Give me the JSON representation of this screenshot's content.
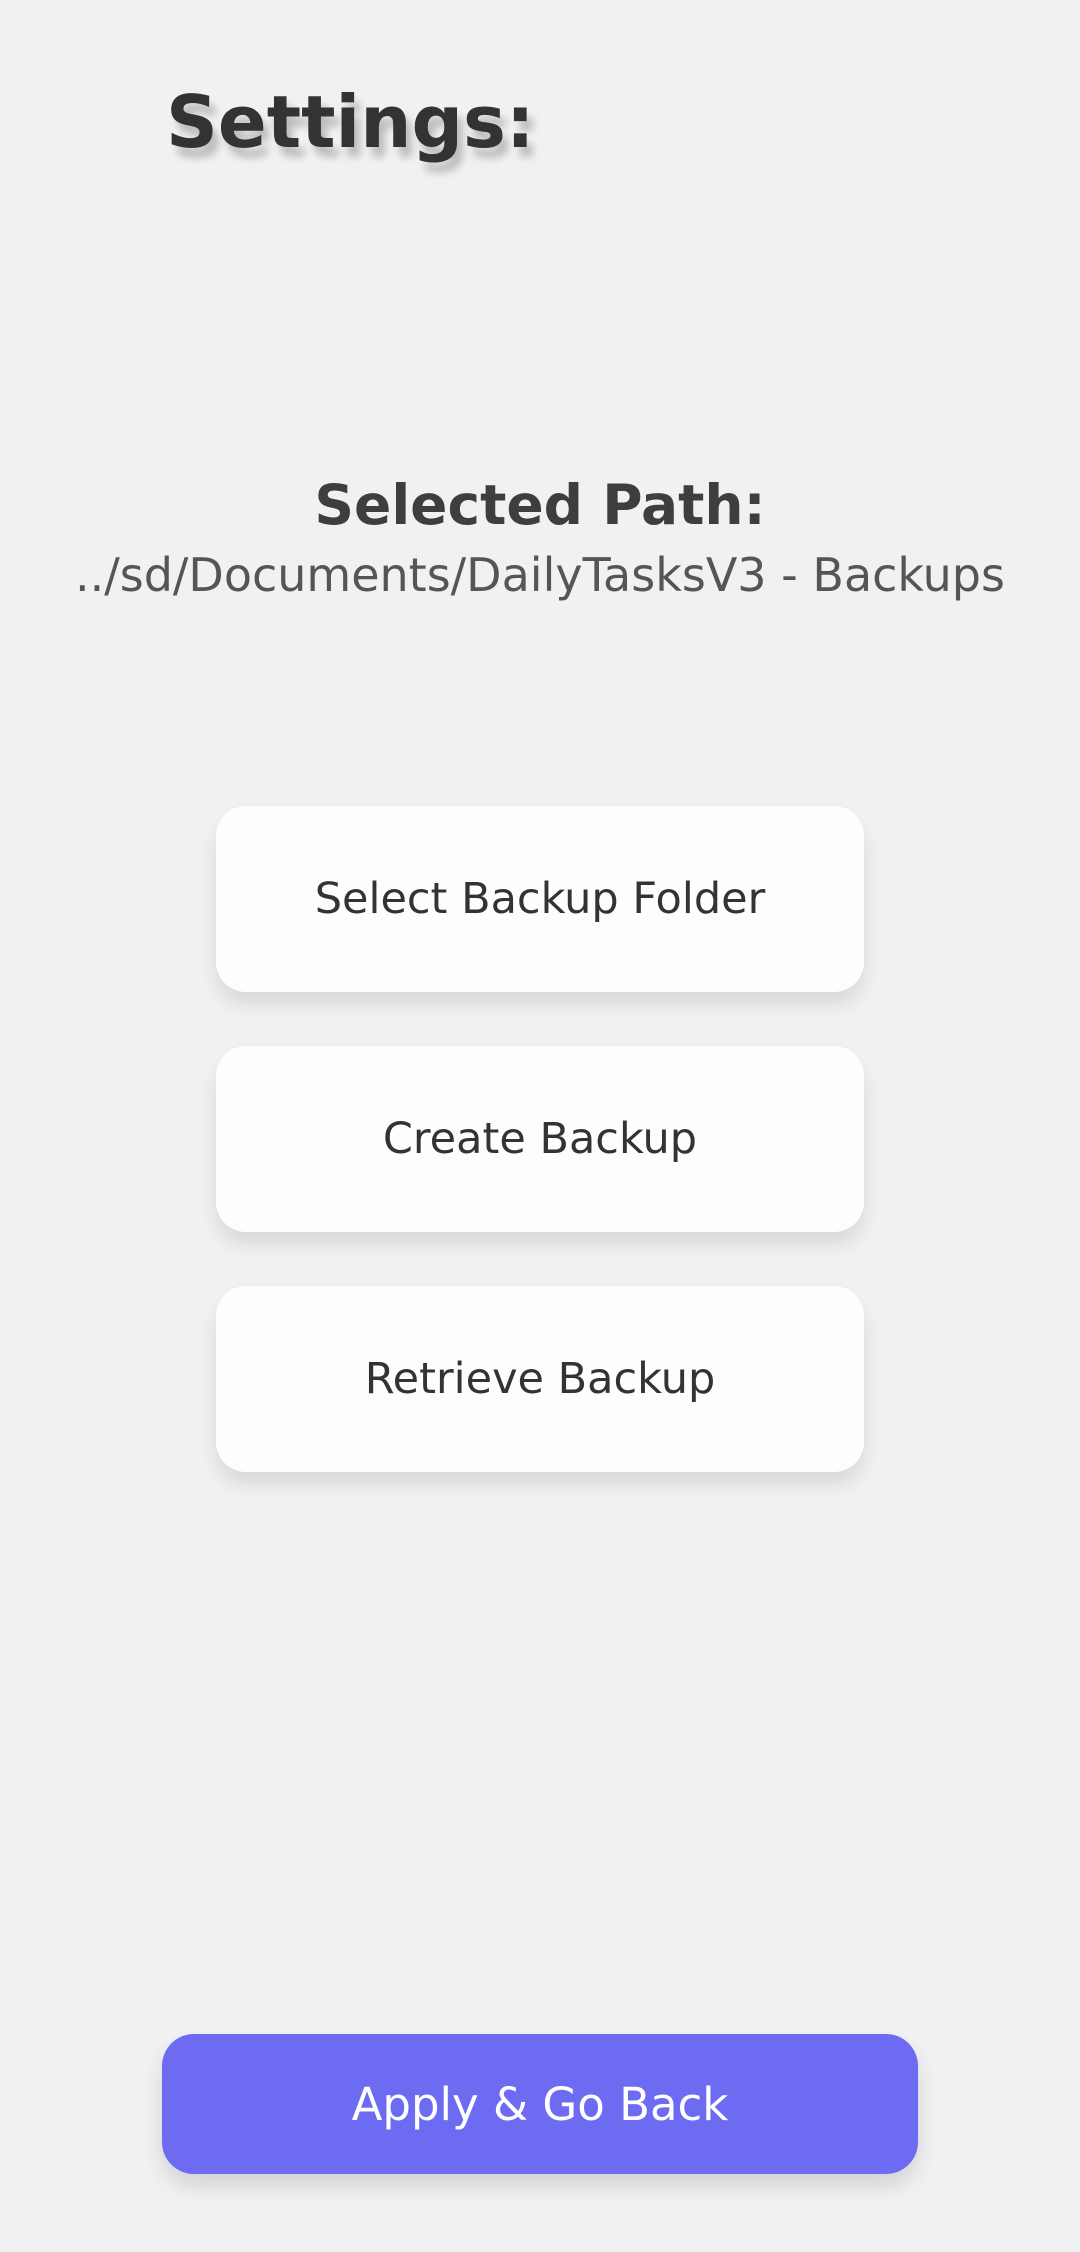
{
  "header": {
    "title": "Settings:"
  },
  "backup_path": {
    "heading": "Selected Path:",
    "value": "../sd/Documents/DailyTasksV3 - Backups"
  },
  "actions": {
    "select_folder_label": "Select Backup Folder",
    "create_backup_label": "Create Backup",
    "retrieve_backup_label": "Retrieve Backup"
  },
  "footer": {
    "apply_label": "Apply & Go Back"
  },
  "colors": {
    "background": "#f0f1f3",
    "button_surface": "#fdfdfd",
    "accent": "#6c6bf2",
    "text": "#333333"
  }
}
